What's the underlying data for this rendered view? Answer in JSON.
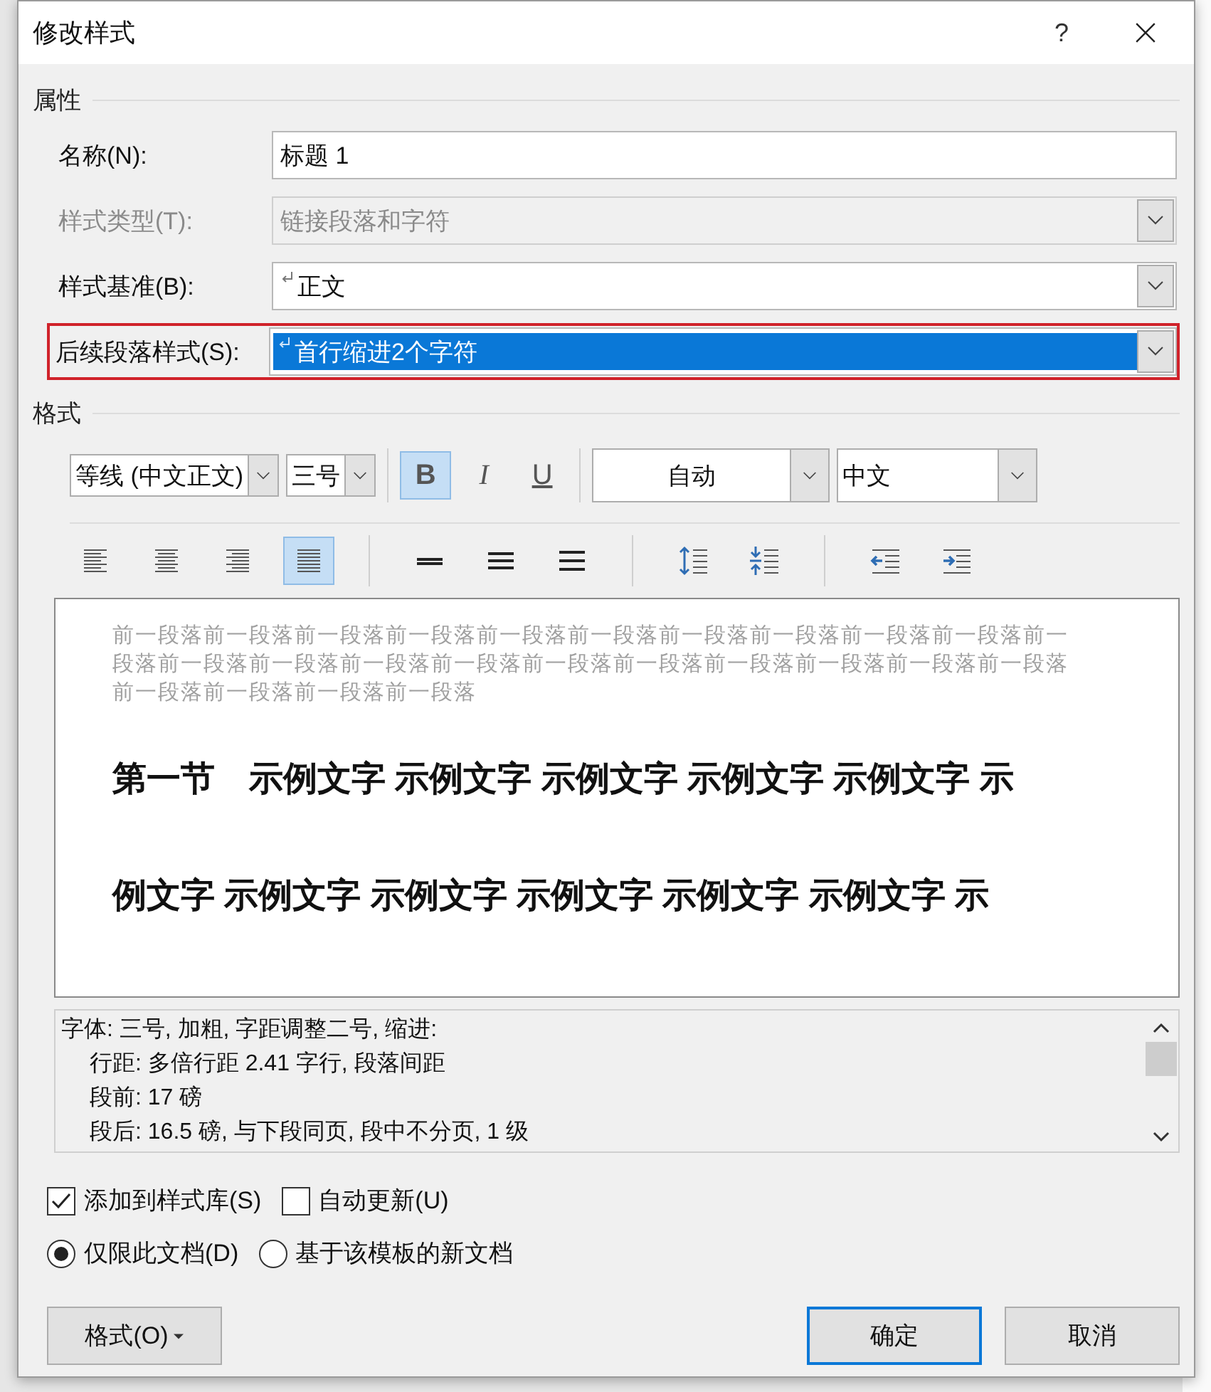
{
  "dialog": {
    "title": "修改样式",
    "help": "?"
  },
  "properties": {
    "heading": "属性",
    "fields": [
      {
        "label": "名称(N):",
        "value": "标题 1",
        "kind": "text",
        "disabled": false,
        "paragraph_style": false,
        "selected": false,
        "highlighted": false
      },
      {
        "label": "样式类型(T):",
        "value": "链接段落和字符",
        "kind": "select",
        "disabled": true,
        "paragraph_style": false,
        "selected": false,
        "highlighted": false
      },
      {
        "label": "样式基准(B):",
        "value": "正文",
        "kind": "select",
        "disabled": false,
        "paragraph_style": true,
        "selected": false,
        "highlighted": false
      },
      {
        "label": "后续段落样式(S):",
        "value": "首行缩进2个字符",
        "kind": "select",
        "disabled": false,
        "paragraph_style": true,
        "selected": true,
        "highlighted": true
      }
    ]
  },
  "format": {
    "heading": "格式",
    "font": "等线 (中文正文)",
    "size": "三号",
    "style_buttons": [
      {
        "kind": "bold",
        "label": "B",
        "selected": true
      },
      {
        "kind": "italic",
        "label": "I",
        "selected": false
      },
      {
        "kind": "underline",
        "label": "U",
        "selected": false
      }
    ],
    "color_label": "自动",
    "language": "中文",
    "align_buttons": [
      {
        "kind": "left",
        "selected": false
      },
      {
        "kind": "center",
        "selected": false
      },
      {
        "kind": "right",
        "selected": false
      },
      {
        "kind": "justify",
        "selected": true
      }
    ],
    "spacing_buttons": [
      {
        "kind": "single"
      },
      {
        "kind": "one-half"
      },
      {
        "kind": "double"
      }
    ],
    "paragraph_buttons": [
      {
        "kind": "increase-spacing"
      },
      {
        "kind": "decrease-spacing"
      }
    ],
    "indent_buttons": [
      {
        "kind": "decrease-indent"
      },
      {
        "kind": "increase-indent"
      }
    ]
  },
  "preview": {
    "previous_paragraph": "前一段落前一段落前一段落前一段落前一段落前一段落前一段落前一段落前一段落前一段落前一段落前一段落前一段落前一段落前一段落前一段落前一段落前一段落前一段落前一段落前一段落前一段落前一段落前一段落前一段落",
    "sample_lines": [
      "第一节　示例文字 示例文字 示例文字 示例文字 示例文字 示",
      "例文字 示例文字 示例文字 示例文字 示例文字 示例文字 示"
    ]
  },
  "description": [
    {
      "text": "字体: 三号, 加粗, 字距调整二号, 缩进:",
      "indented": false
    },
    {
      "text": "行距: 多倍行距 2.41 字行, 段落间距",
      "indented": true
    },
    {
      "text": "段前: 17 磅",
      "indented": true
    },
    {
      "text": "段后: 16.5 磅, 与下段同页, 段中不分页, 1 级",
      "indented": true
    }
  ],
  "checkboxes": [
    {
      "label": "添加到样式库(S)",
      "checked": true
    },
    {
      "label": "自动更新(U)",
      "checked": false
    }
  ],
  "radios": [
    {
      "label": "仅限此文档(D)",
      "selected": true
    },
    {
      "label": "基于该模板的新文档",
      "selected": false
    }
  ],
  "buttons": [
    {
      "label": "格式(O)",
      "kind": "menu"
    },
    {
      "label": "确定",
      "kind": "default"
    },
    {
      "label": "取消",
      "kind": "normal"
    }
  ]
}
